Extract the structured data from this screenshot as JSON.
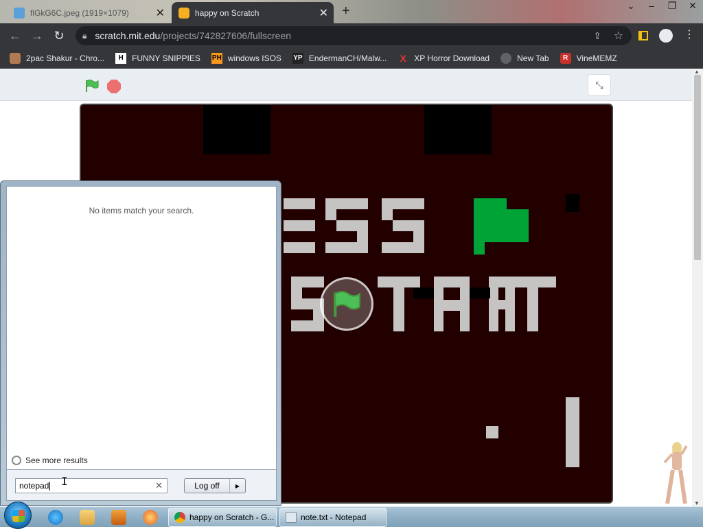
{
  "browser": {
    "tabs": [
      {
        "title": "flGkG6C.jpeg (1919×1079)",
        "active": false
      },
      {
        "title": "happy on Scratch",
        "active": true
      }
    ],
    "url_host": "scratch.mit.edu",
    "url_path": "/projects/742827606/fullscreen",
    "bookmarks": [
      {
        "label": "2pac Shakur - Chro...",
        "icon": "user-icon"
      },
      {
        "label": "FUNNY SNIPPIES",
        "icon": "h-icon"
      },
      {
        "label": "windows ISOS",
        "icon": "ph-icon"
      },
      {
        "label": "EndermanCH/Malw...",
        "icon": "yp-icon"
      },
      {
        "label": "XP Horror Download",
        "icon": "x-icon"
      },
      {
        "label": "New Tab",
        "icon": "globe-icon"
      },
      {
        "label": "VineMEMZ",
        "icon": "r-icon"
      }
    ],
    "bookmark_glyphs": {
      "h": "H",
      "ph": "PH",
      "yp": "YP",
      "x": "X",
      "r": "R"
    }
  },
  "scratch": {
    "stage_bg": "#220000",
    "text_color": "#c6c3c3",
    "flag_color": "#00a335"
  },
  "startmenu": {
    "no_results": "No items match your search.",
    "see_more": "See more results",
    "search_value": "notepad",
    "logoff": "Log off"
  },
  "taskbar": {
    "tasks": [
      {
        "label": "happy on Scratch - G...",
        "icon": "chrome-icon"
      },
      {
        "label": "note.txt - Notepad",
        "icon": "notepad-icon"
      }
    ]
  }
}
